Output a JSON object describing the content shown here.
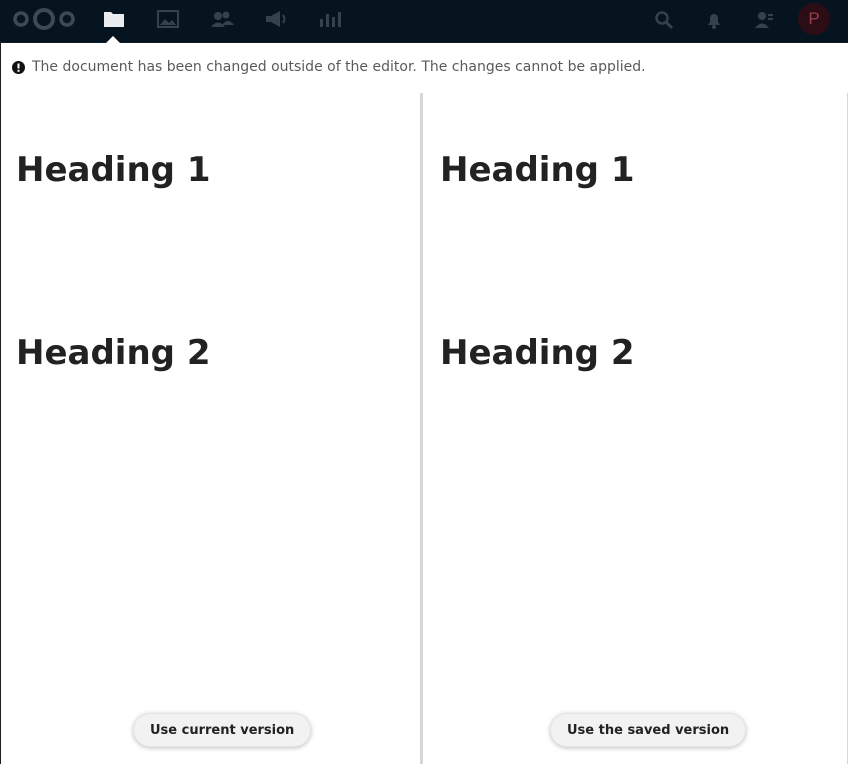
{
  "header": {
    "logo_icon": "nextcloud-logo-icon",
    "apps": [
      {
        "icon": "folder-icon",
        "active": true
      },
      {
        "icon": "photos-icon",
        "active": false
      },
      {
        "icon": "contacts-icon",
        "active": false
      },
      {
        "icon": "announcements-icon",
        "active": false
      },
      {
        "icon": "activity-chart-icon",
        "active": false
      }
    ],
    "right_icons": [
      "search-icon",
      "notifications-bell-icon",
      "contacts-menu-icon"
    ],
    "avatar_initial": "P",
    "avatar_color": "#3b0b12"
  },
  "notice": {
    "icon": "alert-circle-icon",
    "text": "The document has been changed outside of the editor. The changes cannot be applied."
  },
  "panes": {
    "current": {
      "heading1": "Heading 1",
      "heading2": "Heading 2",
      "button_label": "Use current version"
    },
    "saved": {
      "heading1": "Heading 1",
      "heading2": "Heading 2",
      "button_label": "Use the saved version"
    }
  },
  "colors": {
    "header_bg": "#06141f",
    "divider": "#d6d6d6",
    "button_bg": "#f2f2f2",
    "text": "#222222"
  }
}
